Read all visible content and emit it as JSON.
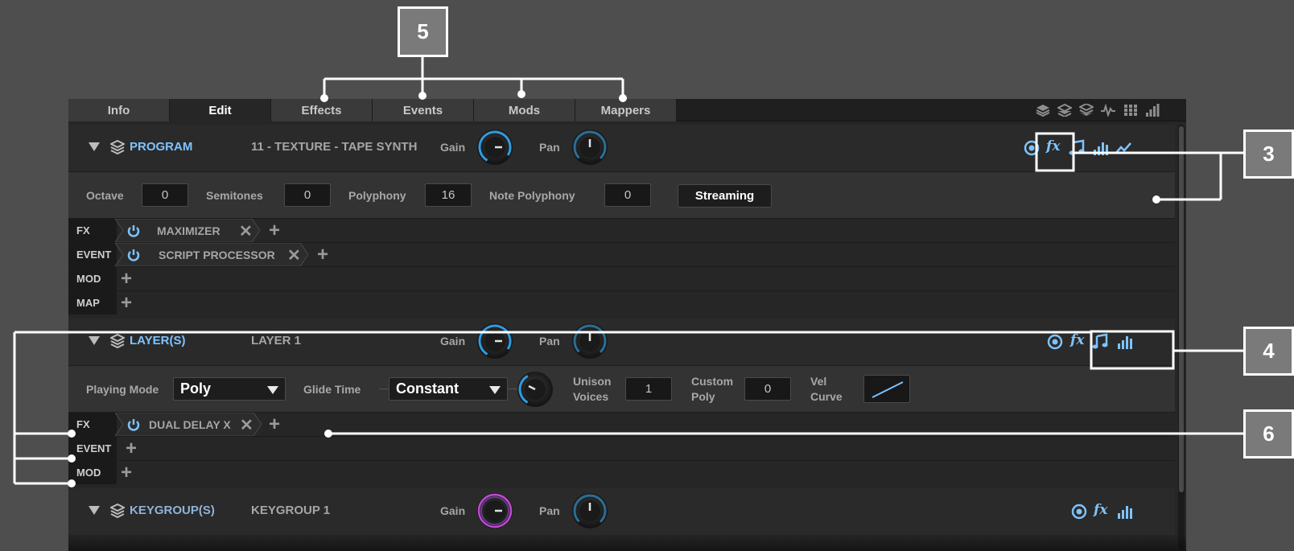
{
  "tabs": [
    "Info",
    "Edit",
    "Effects",
    "Events",
    "Mods",
    "Mappers"
  ],
  "active_tab": "Edit",
  "toolbar_icons": [
    "layers-icon",
    "layers-alt-icon",
    "layers-stack-icon",
    "waveform-icon",
    "grid-icon",
    "bar-meter-icon"
  ],
  "program": {
    "title": "PROGRAM",
    "name": "11 - TEXTURE - TAPE SYNTH",
    "gain_label": "Gain",
    "pan_label": "Pan",
    "icons": [
      "target-icon",
      "fx-icon",
      "note-icon",
      "bar-meter-icon",
      "curve-icon"
    ],
    "fx_glyph": "fx",
    "octave_label": "Octave",
    "octave": "0",
    "semitones_label": "Semitones",
    "semitones": "0",
    "polyphony_label": "Polyphony",
    "polyphony": "16",
    "note_polyphony_label": "Note Polyphony",
    "note_polyphony": "0",
    "streaming_label": "Streaming",
    "chains": [
      {
        "label": "FX",
        "slot": "MAXIMIZER"
      },
      {
        "label": "EVENT",
        "slot": "SCRIPT PROCESSOR"
      },
      {
        "label": "MOD"
      },
      {
        "label": "MAP"
      }
    ]
  },
  "layers": {
    "title": "LAYER(S)",
    "name": "LAYER 1",
    "gain_label": "Gain",
    "pan_label": "Pan",
    "fx_glyph": "fx",
    "playing_mode_label": "Playing Mode",
    "playing_mode": "Poly",
    "glide_time_label": "Glide Time",
    "glide_mode": "Constant",
    "unison_voices_label_1": "Unison",
    "unison_voices_label_2": "Voices",
    "unison_voices": "1",
    "custom_poly_label_1": "Custom",
    "custom_poly_label_2": "Poly",
    "custom_poly": "0",
    "vel_curve_label_1": "Vel",
    "vel_curve_label_2": "Curve",
    "chains": [
      {
        "label": "FX",
        "slot": "DUAL DELAY X"
      },
      {
        "label": "EVENT"
      },
      {
        "label": "MOD"
      }
    ]
  },
  "keygroups": {
    "title": "KEYGROUP(S)",
    "name": "KEYGROUP 1",
    "gain_label": "Gain",
    "pan_label": "Pan",
    "fx_glyph": "fx"
  },
  "callouts": [
    "5",
    "3",
    "4",
    "6"
  ],
  "colors": {
    "accent": "#7ec3ff",
    "knob_ring": "#2f9be0",
    "keygroup_ring": "#c04bd0",
    "background": "#4e4e4e"
  }
}
